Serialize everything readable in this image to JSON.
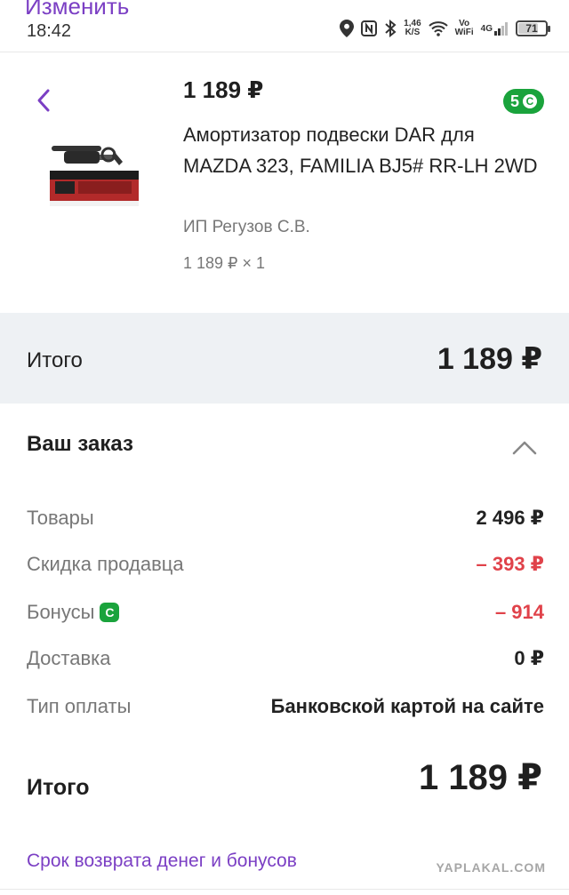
{
  "top_cut_label": "Изменить",
  "status_bar": {
    "time": "18:42",
    "speed_value": "1,46",
    "speed_unit": "K/S",
    "wifi_label_1": "Vo",
    "wifi_label_2": "WiFi",
    "signal_label": "4G",
    "battery": "71"
  },
  "product": {
    "price": "1 189 ₽",
    "bonus_badge": "5",
    "title": "Амортизатор подвески DAR для MAZDA 323, FAMILIA BJ5# RR-LH 2WD",
    "seller": "ИП Регузов С.В.",
    "quantity_line": "1 189 ₽ × 1"
  },
  "total_band": {
    "label": "Итого",
    "value": "1 189 ₽"
  },
  "order": {
    "title": "Ваш заказ",
    "rows": [
      {
        "label": "Товары",
        "value": "2 496 ₽"
      },
      {
        "label": "Скидка продавца",
        "value": "– 393 ₽"
      },
      {
        "label": "Бонусы",
        "value": "– 914"
      },
      {
        "label": "Доставка",
        "value": "0 ₽"
      },
      {
        "label": "Тип оплаты",
        "value": "Банковской картой на сайте"
      }
    ],
    "total_label": "Итого",
    "total_value": "1 189 ₽"
  },
  "refund_link": "Срок возврата денег и бонусов",
  "watermark": "YAPLAKAL.COM",
  "colors": {
    "accent": "#7b3fc4",
    "bonus_green": "#1aa33c",
    "discount_red": "#e0424a",
    "band_bg": "#eef1f4"
  }
}
